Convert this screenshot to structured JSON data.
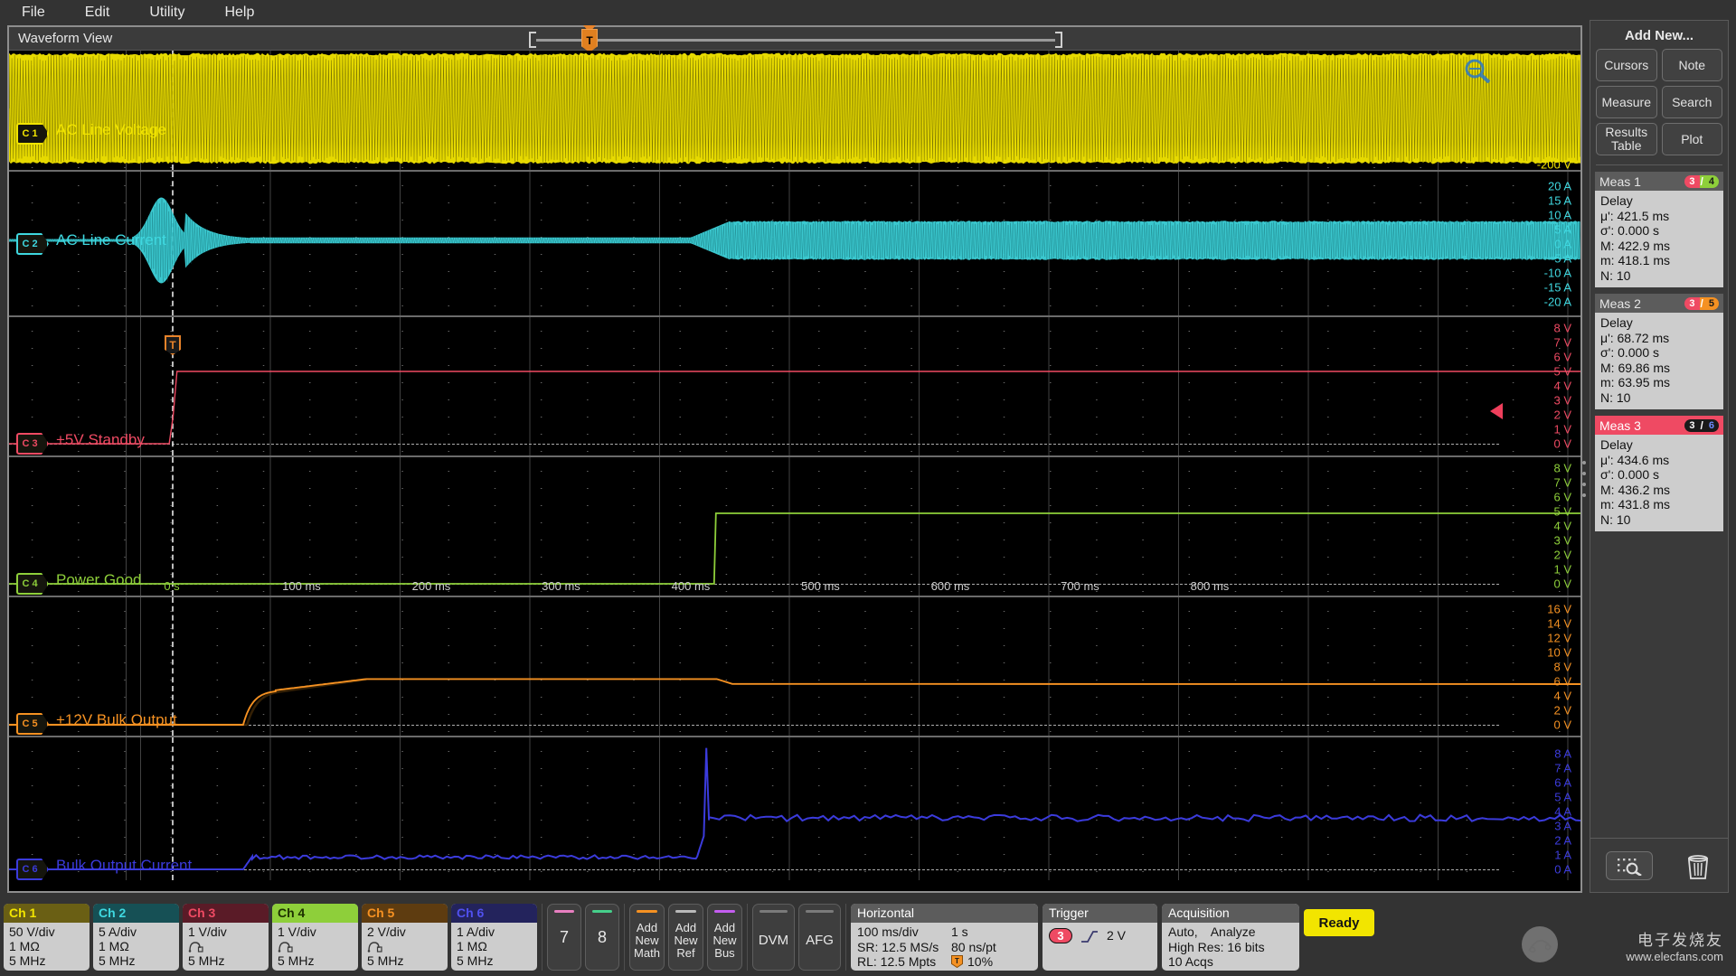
{
  "menubar": {
    "items": [
      "File",
      "Edit",
      "Utility",
      "Help"
    ]
  },
  "waveform_view": {
    "title": "Waveform View",
    "trigger_marker": "T"
  },
  "channels": [
    {
      "badge": "C 1",
      "label": "AC Line Voltage",
      "color": "#f2e500",
      "scale": [
        "-200 V"
      ],
      "bottom_label": "-200 V"
    },
    {
      "badge": "C 2",
      "label": "AC Line Current",
      "color": "#3fd8e0",
      "scale": [
        "20 A",
        "15 A",
        "10 A",
        "5 A",
        "0 A",
        "-5 A",
        "-10 A",
        "-15 A",
        "-20 A"
      ]
    },
    {
      "badge": "C 3",
      "label": "+5V Standby",
      "color": "#ef4a63",
      "scale": [
        "8 V",
        "7 V",
        "6 V",
        "5 V",
        "4 V",
        "3 V",
        "2 V",
        "1 V",
        "0 V"
      ]
    },
    {
      "badge": "C 4",
      "label": "Power Good",
      "color": "#8ecf3a",
      "scale": [
        "8 V",
        "7 V",
        "6 V",
        "5 V",
        "4 V",
        "3 V",
        "2 V",
        "1 V",
        "0 V"
      ]
    },
    {
      "badge": "C 5",
      "label": "+12V Bulk Output",
      "color": "#f59122",
      "scale": [
        "16 V",
        "14 V",
        "12 V",
        "10 V",
        "8 V",
        "6 V",
        "4 V",
        "2 V",
        "0 V"
      ]
    },
    {
      "badge": "C 6",
      "label": "Bulk Output Current",
      "color": "#3b3bdc",
      "scale": [
        "8 A",
        "7 A",
        "6 A",
        "5 A",
        "4 A",
        "3 A",
        "2 A",
        "1 A",
        "0 A"
      ]
    }
  ],
  "time_axis": {
    "ticks": [
      "0 s",
      "100 ms",
      "200 ms",
      "300 ms",
      "400 ms",
      "500 ms",
      "600 ms",
      "700 ms",
      "800 ms"
    ]
  },
  "sidebar": {
    "title": "Add New...",
    "buttons": [
      "Cursors",
      "Note",
      "Measure",
      "Search",
      "Results\nTable",
      "Plot"
    ],
    "tools": {
      "zoom": "zoom-area-icon",
      "delete": "trash-icon"
    },
    "measurements": [
      {
        "name": "Meas 1",
        "highlighted": false,
        "sources": [
          {
            "n": "3",
            "color": "#ef4a63",
            "text": "#ffffff"
          },
          {
            "n": "4",
            "color": "#8ecf3a",
            "text": "#1a1a1a"
          }
        ],
        "type": "Delay",
        "rows": [
          "μ': 421.5 ms",
          "σ': 0.000 s",
          "M: 422.9 ms",
          "m: 418.1 ms",
          "N: 10"
        ]
      },
      {
        "name": "Meas 2",
        "highlighted": false,
        "sources": [
          {
            "n": "3",
            "color": "#ef4a63",
            "text": "#ffffff"
          },
          {
            "n": "5",
            "color": "#f59122",
            "text": "#1a1a1a"
          }
        ],
        "type": "Delay",
        "rows": [
          "μ': 68.72 ms",
          "σ': 0.000 s",
          "M: 69.86 ms",
          "m: 63.95 ms",
          "N: 10"
        ]
      },
      {
        "name": "Meas 3",
        "highlighted": true,
        "sources": [
          {
            "n": "3",
            "color": "#1a1a1a",
            "text": "#ffffff"
          },
          {
            "n": "6",
            "color": "#1a1a1a",
            "text": "#6e8bff"
          }
        ],
        "type": "Delay",
        "rows": [
          "μ': 434.6 ms",
          "σ': 0.000 s",
          "M: 436.2 ms",
          "m: 431.8 ms",
          "N: 10"
        ]
      }
    ]
  },
  "bottombar": {
    "channel_cards": [
      {
        "title": "Ch 1",
        "title_color": "#f2e500",
        "hdr_bg": "#6a5f14",
        "lines": [
          "50 V/div",
          "1 MΩ",
          "5 MHz"
        ],
        "probe_icon": false
      },
      {
        "title": "Ch 2",
        "title_color": "#3fd8e0",
        "hdr_bg": "#165055",
        "lines": [
          "5 A/div",
          "1 MΩ",
          "5 MHz"
        ],
        "probe_icon": false
      },
      {
        "title": "Ch 3",
        "title_color": "#ef4a63",
        "hdr_bg": "#5a1b27",
        "lines": [
          "1 V/div",
          "",
          "5 MHz"
        ],
        "probe_icon": true
      },
      {
        "title": "Ch 4",
        "title_color": "#1d3000",
        "hdr_bg": "#8ecf3a",
        "lines": [
          "1 V/div",
          "",
          "5 MHz"
        ],
        "probe_icon": true
      },
      {
        "title": "Ch 5",
        "title_color": "#f59122",
        "hdr_bg": "#5e3c10",
        "lines": [
          "2 V/div",
          "",
          "5 MHz"
        ],
        "probe_icon": true
      },
      {
        "title": "Ch 6",
        "title_color": "#5050ee",
        "hdr_bg": "#23235c",
        "lines": [
          "1 A/div",
          "1 MΩ",
          "5 MHz"
        ],
        "probe_icon": false
      }
    ],
    "num_buttons": [
      {
        "label": "7",
        "bar_color": "#e87fc0"
      },
      {
        "label": "8",
        "bar_color": "#46cf8b"
      }
    ],
    "add_buttons": [
      {
        "label": "Add\nNew\nMath",
        "bar_color": "#f59122"
      },
      {
        "label": "Add\nNew\nRef",
        "bar_color": "#b9b9b9"
      },
      {
        "label": "Add\nNew\nBus",
        "bar_color": "#c45df0"
      }
    ],
    "util_buttons": [
      {
        "label": "DVM",
        "bar_color": "#7a7a7a"
      },
      {
        "label": "AFG",
        "bar_color": "#7a7a7a"
      }
    ],
    "horizontal": {
      "title": "Horizontal",
      "scale": "100 ms/div",
      "total": "1 s",
      "sr_label": "SR: 12.5 MS/s",
      "resolution": "80 ns/pt",
      "rl_label": "RL: 12.5 Mpts",
      "position": "10%"
    },
    "trigger": {
      "title": "Trigger",
      "source": "3",
      "slope": "rising-edge-icon",
      "level": "2 V"
    },
    "acquisition": {
      "title": "Acquisition",
      "mode": "Auto,",
      "action": "Analyze",
      "resolution": "High Res: 16 bits",
      "acqs": "10 Acqs"
    },
    "status": "Ready"
  },
  "watermark": {
    "cn": "电子发烧友",
    "url": "www.elecfans.com"
  }
}
